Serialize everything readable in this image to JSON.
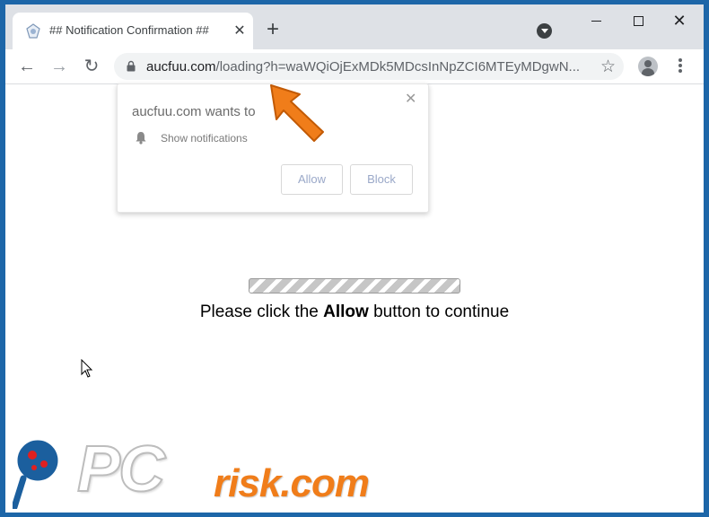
{
  "browser": {
    "tab_title": "## Notification Confirmation ##",
    "tab_close": "✕",
    "new_tab": "+",
    "window_close": "✕",
    "url_host": "aucfuu.com",
    "url_path": "/loading?h=waWQiOjExMDk5MDcsInNpZCI6MTEyMDgwN...",
    "back_icon": "←",
    "forward_icon": "→",
    "reload_icon": "↻",
    "star_icon": "☆"
  },
  "popup": {
    "title": "aucfuu.com wants to",
    "permission": "Show notifications",
    "close": "✕",
    "allow_label": "Allow",
    "block_label": "Block"
  },
  "page": {
    "message_before": "Please click the ",
    "message_bold": "Allow",
    "message_after": " button to continue"
  },
  "watermark": {
    "pc": "PC",
    "risk": "risk.com"
  },
  "colors": {
    "accent_orange": "#f07d1a",
    "frame_blue": "#1d66a8"
  }
}
